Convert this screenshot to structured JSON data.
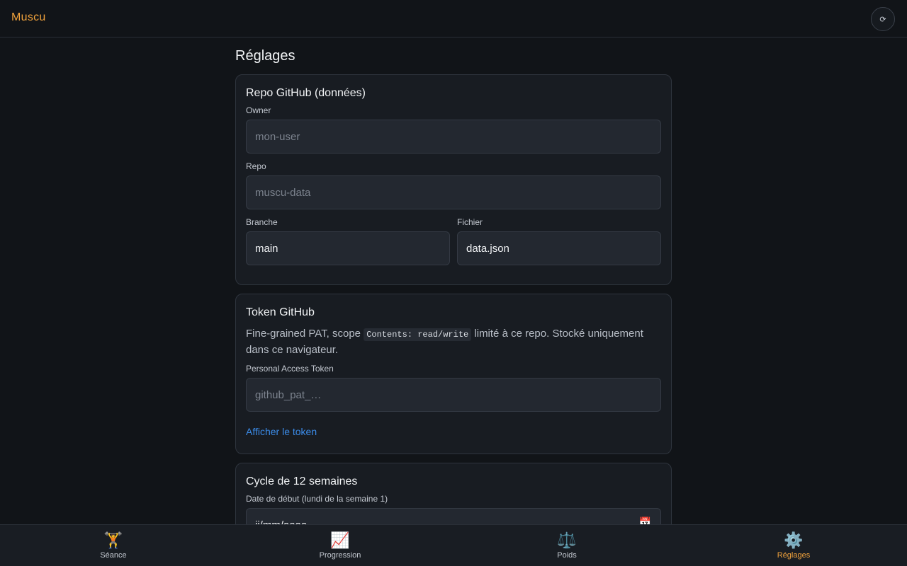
{
  "app": {
    "brand": "Muscu",
    "sync_icon": "⟳"
  },
  "page": {
    "title": "Réglages"
  },
  "repo_card": {
    "title": "Repo GitHub (données)",
    "owner_label": "Owner",
    "owner_placeholder": "mon-user",
    "repo_label": "Repo",
    "repo_placeholder": "muscu-data",
    "branch_label": "Branche",
    "branch_value": "main",
    "file_label": "Fichier",
    "file_value": "data.json"
  },
  "token_card": {
    "title": "Token GitHub",
    "desc_before": "Fine-grained PAT, scope ",
    "desc_code": "Contents: read/write",
    "desc_after": " limité à ce repo. Stocké uniquement dans ce navigateur.",
    "pat_label": "Personal Access Token",
    "pat_placeholder": "github_pat_…",
    "show_link": "Afficher le token"
  },
  "cycle_card": {
    "title": "Cycle de 12 semaines",
    "start_label": "Date de début (lundi de la semaine 1)",
    "start_value": "jj/mm/aaaa"
  },
  "tabs": [
    {
      "icon": "🏋️",
      "label": "Séance",
      "active": false
    },
    {
      "icon": "📈",
      "label": "Progression",
      "active": false
    },
    {
      "icon": "⚖️",
      "label": "Poids",
      "active": false
    },
    {
      "icon": "⚙️",
      "label": "Réglages",
      "active": true
    }
  ],
  "colors": {
    "accent": "#f0a23c",
    "link": "#3b8be8",
    "background": "#111418"
  }
}
